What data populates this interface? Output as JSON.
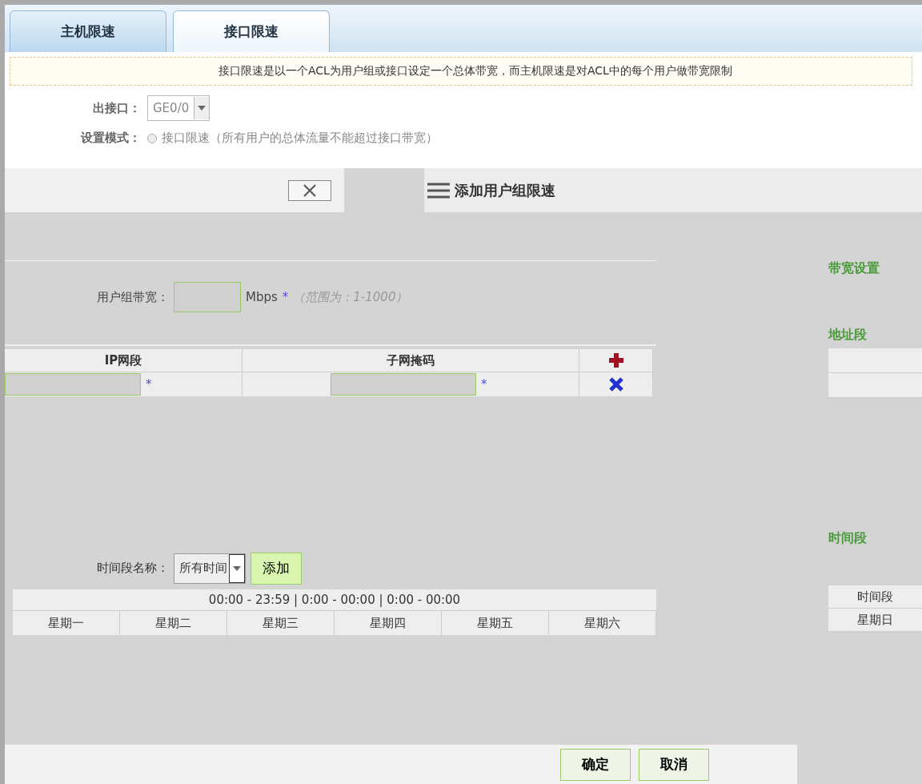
{
  "tabs": [
    {
      "label": "主机限速",
      "selected": false
    },
    {
      "label": "接口限速",
      "selected": true
    }
  ],
  "notice": "接口限速是以一个ACL为用户组或接口设定一个总体带宽，而主机限速是对ACL中的每个用户做带宽限制",
  "out_interface": {
    "label": "出接口：",
    "value": "GE0/0"
  },
  "mode": {
    "label": "设置模式：",
    "option": "接口限速（所有用户的总体流量不能超过接口带宽）",
    "selected": false
  },
  "dialog": {
    "title": "添加用户组限速"
  },
  "bandwidth": {
    "label": "用户组带宽：",
    "unit": "Mbps",
    "mark": "*",
    "hint": "（范围为：1-1000）"
  },
  "address_table": {
    "columns": [
      "IP网段",
      "子网掩码"
    ],
    "rows": [
      {
        "ip_mark": "*",
        "mask_mark": "*"
      }
    ]
  },
  "time": {
    "label": "时间段名称：",
    "value": "所有时间",
    "add_button": "添加",
    "summary": "00:00 - 23:59 | 0:00 - 00:00 | 0:00 - 00:00",
    "days": [
      "星期一",
      "星期二",
      "星期三",
      "星期四",
      "星期五",
      "星期六"
    ]
  },
  "buttons": [
    "确定",
    "取消"
  ],
  "right_panel": {
    "legends": [
      "带宽设置",
      "地址段",
      "时间段"
    ],
    "cells": [
      "时间段",
      "星期日"
    ]
  }
}
